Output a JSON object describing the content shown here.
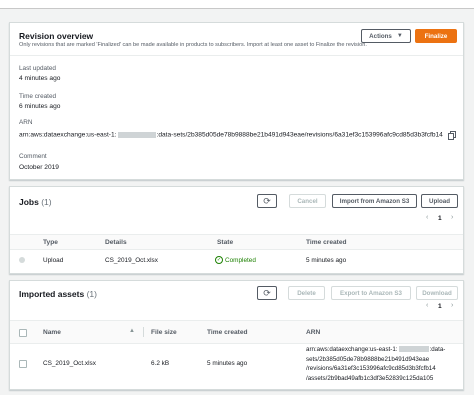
{
  "revision": {
    "title": "Revision overview",
    "subtitle": "Only revisions that are marked 'Finalized' can be made available in products to subscribers. Import at least one asset to Finalize the revision.",
    "actions_label": "Actions",
    "finalize_label": "Finalize",
    "last_updated_label": "Last updated",
    "last_updated_value": "4 minutes ago",
    "time_created_label": "Time created",
    "time_created_value": "6 minutes ago",
    "arn_label": "ARN",
    "arn_prefix": "arn:aws:dataexchange:us-east-1:",
    "arn_suffix": ":data-sets/2b385d05de78b9888be21b491d943eae/revisions/6a31ef3c153996afc9cd85d3b3fcfb14",
    "comment_label": "Comment",
    "comment_value": "October 2019"
  },
  "jobs": {
    "title": "Jobs",
    "count": "(1)",
    "cancel_label": "Cancel",
    "import_s3_label": "Import from Amazon S3",
    "upload_label": "Upload",
    "page": "1",
    "columns": [
      "Type",
      "Details",
      "State",
      "Time created"
    ],
    "rows": [
      {
        "type": "Upload",
        "details": "CS_2019_Oct.xlsx",
        "state": "Completed",
        "time_created": "5 minutes ago"
      }
    ]
  },
  "assets": {
    "title": "Imported assets",
    "count": "(1)",
    "delete_label": "Delete",
    "export_label": "Export to Amazon S3",
    "download_label": "Download",
    "page": "1",
    "columns": [
      "Name",
      "File size",
      "Time created",
      "ARN"
    ],
    "rows": [
      {
        "name": "CS_2019_Oct.xlsx",
        "size": "6.2 kB",
        "time_created": "5 minutes ago",
        "arn_line1": "arn:aws:dataexchange:us-east-1:",
        "arn_line1_tail": ":data-",
        "arn_line2": "sets/2b385d05de78b9888be21b491d943eae",
        "arn_line3": "/revisions/6a31ef3c153996afc9cd85d3b3fcfb14",
        "arn_line4": "/assets/2b9bad49afb1c3df3e52839c125da105"
      }
    ]
  },
  "colors": {
    "accent": "#ec7211",
    "success": "#1d8102",
    "link": "#0073bb"
  },
  "icons": [
    "refresh-icon",
    "chevron-down-icon",
    "copy-icon",
    "chevron-left-icon",
    "chevron-right-icon",
    "success-icon",
    "sort-icon"
  ]
}
